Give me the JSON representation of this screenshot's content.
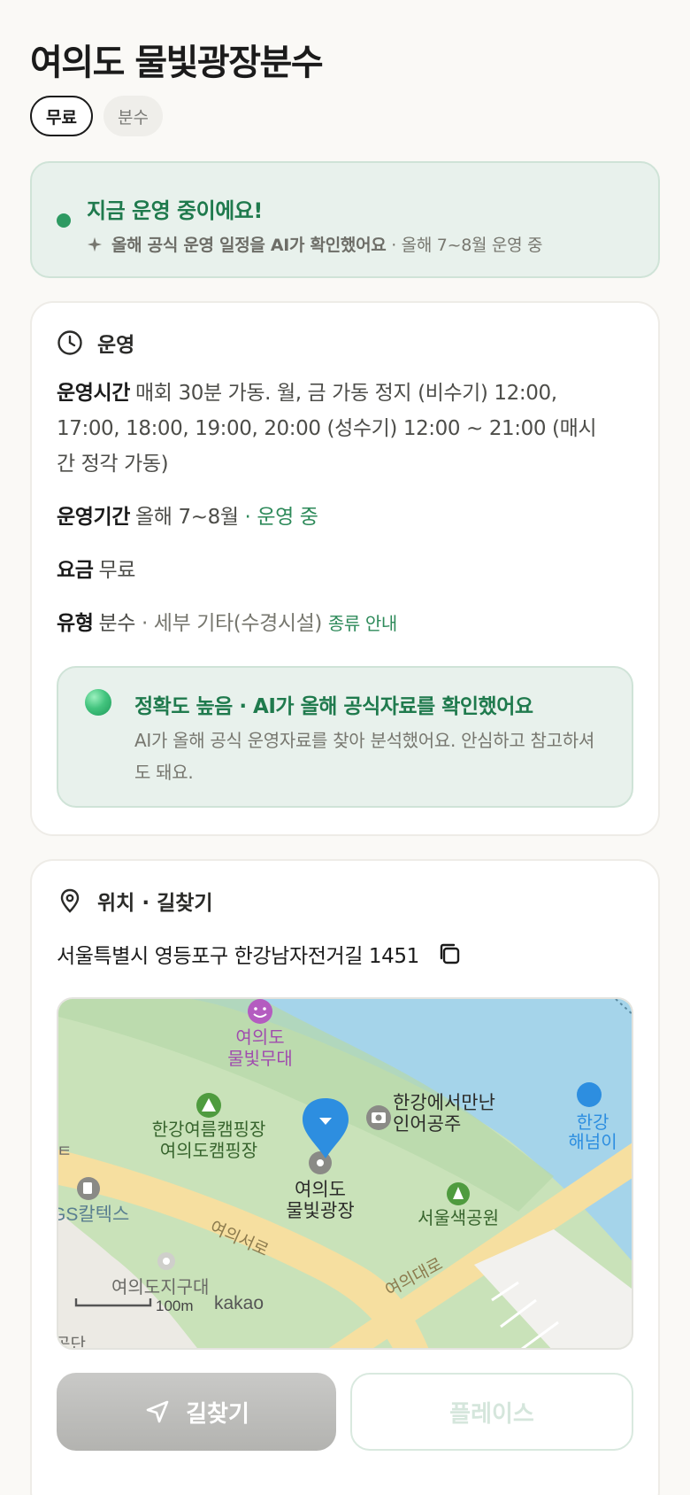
{
  "place": {
    "title": "여의도 물빛광장분수",
    "chips": [
      "무료",
      "분수"
    ]
  },
  "status": {
    "title": "지금 운영 중이에요!",
    "sub_bold": "올해 공식 운영 일정을 AI가 확인했어요",
    "sub_rest": "· 올해 7~8월 운영 중"
  },
  "operation": {
    "heading": "운영",
    "hours_label": "운영시간",
    "hours_value": "매회 30분 가동. 월, 금 가동 정지 (비수기) 12:00, 17:00, 18:00, 19:00, 20:00 (성수기) 12:00 ~ 21:00 (매시간 정각 가동)",
    "period_label": "운영기간",
    "period_value": "올해 7~8월",
    "period_status": "· 운영 중",
    "fee_label": "요금",
    "fee_value": "무료",
    "type_label": "유형",
    "type_value": "분수",
    "type_detail": "· 세부 기타(수경시설)",
    "type_link": "종류 안내",
    "accuracy_title": "정확도 높음 · AI가 올해 공식자료를 확인했어요",
    "accuracy_body": "AI가 올해 공식 운영자료를 찾아 분석했어요. 안심하고 참고하셔도 돼요."
  },
  "location": {
    "heading": "위치 · 길찾기",
    "address": "서울특별시 영등포구 한강남자전거길 1451",
    "map_labels": {
      "stage_1": "여의도",
      "stage_2": "물빛무대",
      "camp_1": "한강여름캠핑장",
      "camp_2": "여의도캠핑장",
      "mermaid_1": "한강에서만난",
      "mermaid_2": "인어공주",
      "han_1": "한강",
      "han_2": "해넘이",
      "plaza_1": "여의도",
      "plaza_2": "물빛광장",
      "color_park": "서울색공원",
      "gs": "GS칼텍스",
      "yeouiseo": "여의서로",
      "yeouidae": "여의대로",
      "district": "여의도지구대",
      "scale": "100m",
      "kakao": "kakao",
      "gongdan": "공단",
      "edge_glyph": "ㅌ"
    }
  },
  "actions": {
    "route": "길찾기",
    "place": "플레이스"
  }
}
